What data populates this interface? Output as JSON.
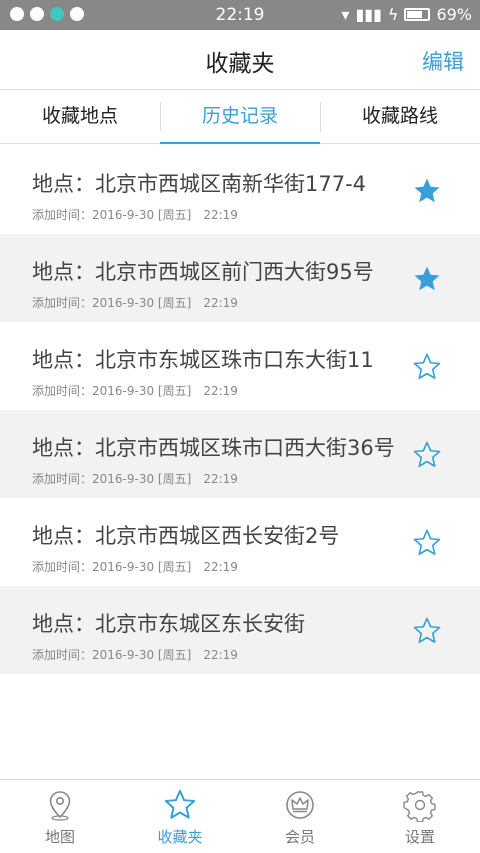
{
  "status_bar": {
    "time": "22:19",
    "battery": "69%"
  },
  "header": {
    "title": "收藏夹",
    "edit_label": "编辑"
  },
  "tabs": [
    {
      "label": "收藏地点",
      "active": false
    },
    {
      "label": "历史记录",
      "active": true
    },
    {
      "label": "收藏路线",
      "active": false
    }
  ],
  "history": [
    {
      "address": "地点：北京市西城区南新华街177-4",
      "added_label": "添加时间：",
      "date": "2016-9-30 [周五]",
      "time": "22:19",
      "starred": true
    },
    {
      "address": "地点：北京市西城区前门西大街95号",
      "added_label": "添加时间：",
      "date": "2016-9-30 [周五]",
      "time": "22:19",
      "starred": true
    },
    {
      "address": "地点：北京市东城区珠市口东大街11",
      "added_label": "添加时间：",
      "date": "2016-9-30 [周五]",
      "time": "22:19",
      "starred": false
    },
    {
      "address": "地点：北京市西城区珠市口西大街36号",
      "added_label": "添加时间：",
      "date": "2016-9-30 [周五]",
      "time": "22:19",
      "starred": false
    },
    {
      "address": "地点：北京市西城区西长安街2号",
      "added_label": "添加时间：",
      "date": "2016-9-30 [周五]",
      "time": "22:19",
      "starred": false
    },
    {
      "address": "地点：北京市东城区东长安街",
      "added_label": "添加时间：",
      "date": "2016-9-30 [周五]",
      "time": "22:19",
      "starred": false
    }
  ],
  "bottom_nav": [
    {
      "label": "地图",
      "icon": "map-pin-icon",
      "active": false
    },
    {
      "label": "收藏夹",
      "icon": "star-icon",
      "active": true
    },
    {
      "label": "会员",
      "icon": "crown-icon",
      "active": false
    },
    {
      "label": "设置",
      "icon": "gear-icon",
      "active": false
    }
  ],
  "colors": {
    "accent": "#3a9ed8",
    "alt_row": "#f2f2f2",
    "status_bar": "#888888"
  }
}
